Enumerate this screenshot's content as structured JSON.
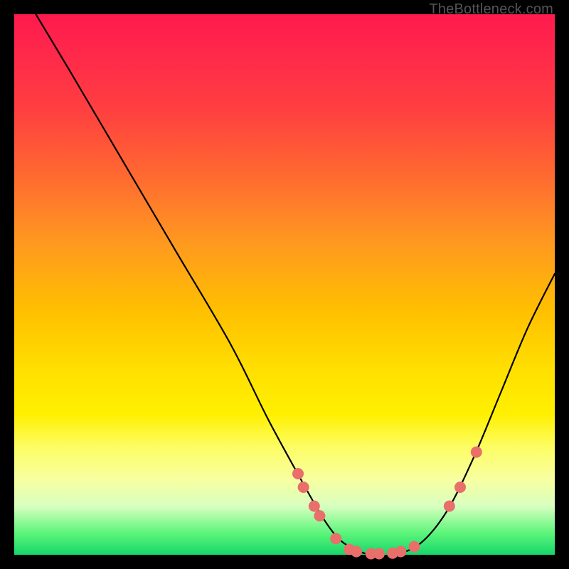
{
  "watermark": "TheBottleneck.com",
  "chart_data": {
    "type": "line",
    "title": "",
    "xlabel": "",
    "ylabel": "",
    "xlim": [
      0,
      100
    ],
    "ylim": [
      0,
      100
    ],
    "series": [
      {
        "name": "curve",
        "x": [
          4,
          10,
          20,
          30,
          40,
          47,
          53,
          57,
          60,
          63,
          66,
          70,
          75,
          80,
          85,
          90,
          95,
          100
        ],
        "y": [
          100,
          90,
          73,
          56,
          39,
          25,
          14,
          7,
          3,
          1,
          0,
          0,
          2,
          8,
          18,
          30,
          42,
          52
        ]
      }
    ],
    "markers": [
      {
        "x": 52.5,
        "y": 15.0
      },
      {
        "x": 53.5,
        "y": 12.5
      },
      {
        "x": 55.5,
        "y": 9.0
      },
      {
        "x": 56.5,
        "y": 7.2
      },
      {
        "x": 59.5,
        "y": 3.0
      },
      {
        "x": 62.0,
        "y": 1.0
      },
      {
        "x": 63.3,
        "y": 0.6
      },
      {
        "x": 66.0,
        "y": 0.2
      },
      {
        "x": 67.5,
        "y": 0.2
      },
      {
        "x": 70.0,
        "y": 0.3
      },
      {
        "x": 71.5,
        "y": 0.6
      },
      {
        "x": 74.0,
        "y": 1.5
      },
      {
        "x": 80.5,
        "y": 9.0
      },
      {
        "x": 82.5,
        "y": 12.5
      },
      {
        "x": 85.5,
        "y": 19.0
      }
    ],
    "marker_color": "#e96f6b",
    "curve_color": "#000000"
  }
}
